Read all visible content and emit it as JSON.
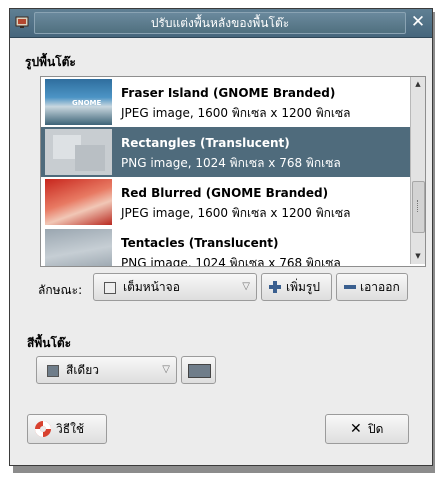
{
  "window": {
    "title": "ปรับแต่งพื้นหลังของพื้นโต๊ะ",
    "close_glyph": "✕"
  },
  "wallpaper_section": {
    "label": "รูปพื้นโต๊ะ",
    "items": [
      {
        "title": "Fraser Island (GNOME Branded)",
        "subtitle": "JPEG image, 1600 พิกเซล x 1200 พิกเซล",
        "thumb_text": "GNOME",
        "selected": false
      },
      {
        "title": "Rectangles (Translucent)",
        "subtitle": "PNG image, 1024 พิกเซล x 768 พิกเซล",
        "selected": true
      },
      {
        "title": "Red Blurred (GNOME Branded)",
        "subtitle": "JPEG image, 1600 พิกเซล x 1200 พิกเซล",
        "selected": false
      },
      {
        "title": "Tentacles (Translucent)",
        "subtitle": "PNG image, 1024 พิกเซล x 768 พิกเซล",
        "selected": false
      }
    ]
  },
  "style_row": {
    "label": "ลักษณะ:",
    "style_value": "เต็มหน้าจอ",
    "add_label": "เพิ่มรูป",
    "remove_label": "เอาออก"
  },
  "color_section": {
    "label": "สีพื้นโต๊ะ",
    "shading_value": "สีเดียว",
    "color": "#6f7d8a"
  },
  "footer": {
    "help_label": "วิธีใช้",
    "close_label": "ปิด"
  },
  "colors": {
    "selection": "#4f6b7c",
    "titlebar": "#46667c",
    "dialog": "#ececec"
  }
}
